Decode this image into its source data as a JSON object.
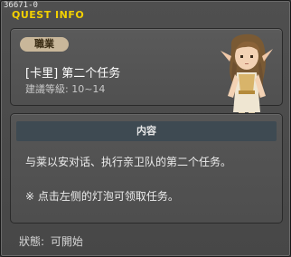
{
  "window": {
    "quest_id": "36671-0",
    "title": "QUEST INFO"
  },
  "header": {
    "job_badge": "職業",
    "quest_name": "[卡里] 第二个任务",
    "level_label": "建議等級",
    "level_range": "10~14"
  },
  "npc": {
    "icon": "elf-npc-portrait"
  },
  "content": {
    "header_label": "内容",
    "description": "与莱以安对话、执行亲卫队的第二个任务。",
    "note": "※  点击左侧的灯泡可领取任务。"
  },
  "status": {
    "label": "狀態",
    "value": "可開始"
  },
  "colors": {
    "title": "#f2d000",
    "badge": "#c9b79a",
    "content_header": "#3e4a52"
  }
}
